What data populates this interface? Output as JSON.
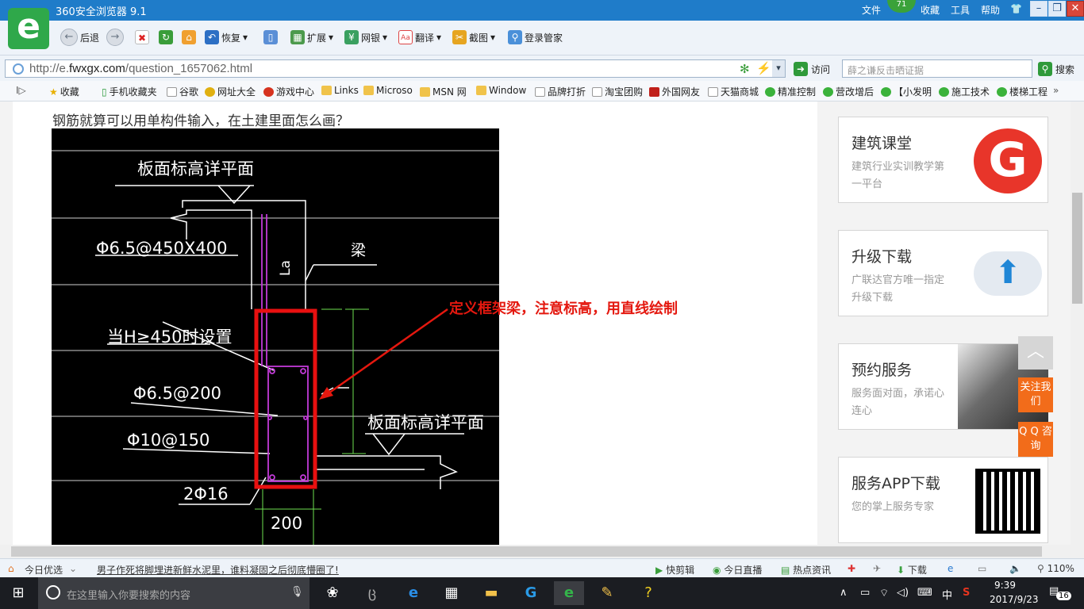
{
  "browser": {
    "title": "360安全浏览器 9.1",
    "menus": [
      "文件",
      "收藏",
      "工具",
      "帮助"
    ],
    "badge": "71"
  },
  "toolbar": {
    "back": "后退",
    "restore": "恢复",
    "extend": "扩展",
    "netbank": "网银",
    "translate": "翻译",
    "screenshot": "截图",
    "login": "登录管家"
  },
  "address": {
    "prefix": "http://e.",
    "domain": "fwxgx.com",
    "path": "/question_1657062.html",
    "visit": "访问",
    "search_placeholder": "薛之谦反击晒证据",
    "search_btn": "搜索"
  },
  "favorites": [
    "收藏",
    "手机收藏夹",
    "谷歌",
    "网址大全",
    "游戏中心",
    "Links",
    "Microso",
    "MSN 网",
    "Window",
    "品牌打折",
    "淘宝团购",
    "外国网友",
    "天猫商城",
    "精准控制",
    "营改增后",
    "【小发明",
    "施工技术",
    "楼梯工程"
  ],
  "page": {
    "question": "钢筋就算可以用单构件输入，在土建里面怎么画？",
    "annotation": "定义框架梁，注意标高，用直线绘制"
  },
  "cad_labels": {
    "top_elev": "板面标高详平面",
    "stirrup1": "Φ6.5@450X400",
    "beam": "梁",
    "la": "La",
    "cond": "当H≥450时设置",
    "stirrup2": "Φ6.5@200",
    "right_elev": "板面标高详平面",
    "stirrup3": "Φ10@150",
    "bars": "2Φ16",
    "width": "200"
  },
  "sidebar": [
    {
      "title": "建筑课堂",
      "desc": "建筑行业实训教学第一平台"
    },
    {
      "title": "升级下载",
      "desc": "广联达官方唯一指定升级下载"
    },
    {
      "title": "预约服务",
      "desc": "服务面对面，承诺心连心"
    },
    {
      "title": "服务APP下载",
      "desc": "您的掌上服务专家"
    }
  ],
  "float": {
    "follow": "关注我们",
    "qq": "Q Q 咨询"
  },
  "status": {
    "today": "今日优选",
    "headline": "男子作死将脚埋进新鲜水泥里，谁料凝固之后彻底懵圈了!",
    "clip": "快剪辑",
    "live": "今日直播",
    "hot": "热点资讯",
    "download": "下载",
    "zoom": "110%"
  },
  "taskbar": {
    "search": "在这里输入你要搜索的内容",
    "ime": "中",
    "time": "9:39",
    "date": "2017/9/23",
    "notif": "16"
  }
}
